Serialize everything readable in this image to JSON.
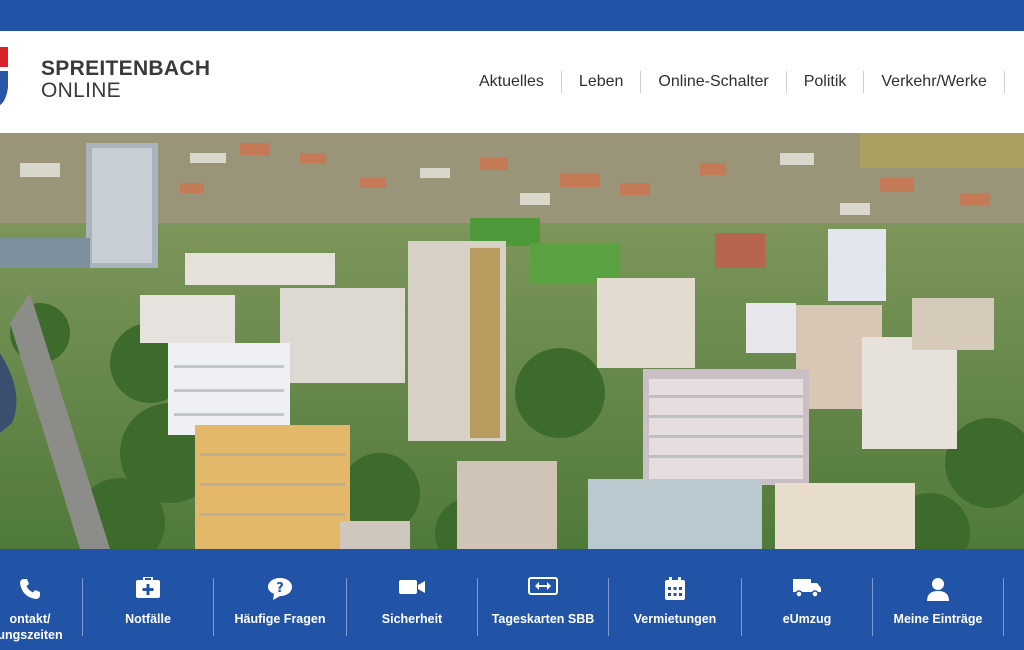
{
  "site": {
    "brand_line1": "SPREITENBACH",
    "brand_line2": "ONLINE",
    "colors": {
      "primary_blue": "#2153a6",
      "text_dark": "#2f2f2f",
      "crest_red": "#d8232a"
    }
  },
  "nav": {
    "items": [
      {
        "label": "Aktuelles"
      },
      {
        "label": "Leben"
      },
      {
        "label": "Online-Schalter"
      },
      {
        "label": "Politik"
      },
      {
        "label": "Verkehr/Werke"
      }
    ]
  },
  "hero": {
    "image": "aerial-photo-spreitenbach-high-rise-buildings"
  },
  "quicklinks": {
    "items": [
      {
        "icon": "phone-icon",
        "label_line1": "ontakt/",
        "label_line2": "ungszeiten"
      },
      {
        "icon": "first-aid-icon",
        "label_line1": "Notfälle"
      },
      {
        "icon": "question-bubble-icon",
        "label_line1": "Häufige Fragen"
      },
      {
        "icon": "video-camera-icon",
        "label_line1": "Sicherheit"
      },
      {
        "icon": "ticket-icon",
        "label_line1": "Tageskarten SBB"
      },
      {
        "icon": "calendar-icon",
        "label_line1": "Vermietungen"
      },
      {
        "icon": "truck-icon",
        "label_line1": "eUmzug"
      },
      {
        "icon": "user-icon",
        "label_line1": "Meine Einträge"
      }
    ]
  }
}
